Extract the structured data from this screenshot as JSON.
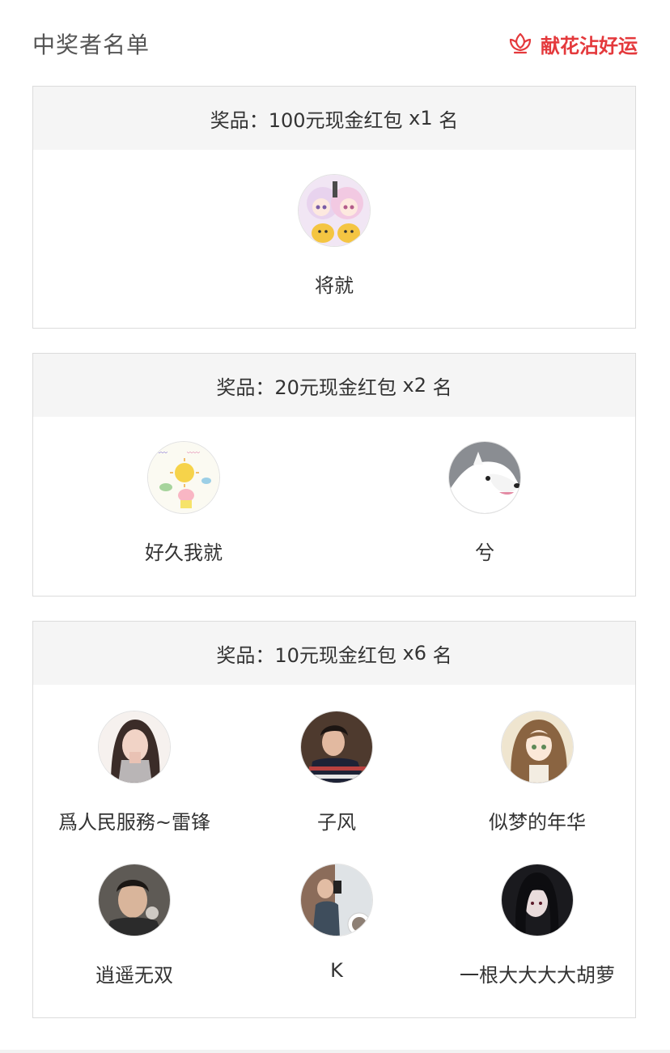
{
  "header": {
    "title": "中奖者名单",
    "flower_label": "献花沾好运",
    "accent_color": "#e4393c"
  },
  "prizes": [
    {
      "prefix": "奖品：",
      "prize": "100元现金红包",
      "count": "x1",
      "unit": "名",
      "winners": [
        {
          "name": "将就",
          "avatar": "anime-girls-avatar"
        }
      ]
    },
    {
      "prefix": "奖品：",
      "prize": "20元现金红包",
      "count": "x2",
      "unit": "名",
      "winners": [
        {
          "name": "好久我就",
          "avatar": "drawing-avatar"
        },
        {
          "name": "兮",
          "avatar": "white-dog-avatar"
        }
      ]
    },
    {
      "prefix": "奖品：",
      "prize": "10元现金红包",
      "count": "x6",
      "unit": "名",
      "winners": [
        {
          "name": "爲人民服務~雷锋",
          "avatar": "woman-selfie-avatar"
        },
        {
          "name": "子风",
          "avatar": "man-striped-shirt-avatar"
        },
        {
          "name": "似梦的年华",
          "avatar": "anime-brown-hair-avatar"
        },
        {
          "name": "逍遥无双",
          "avatar": "man-portrait-avatar"
        },
        {
          "name": "K",
          "avatar": "mirror-selfie-avatar"
        },
        {
          "name": "一根大大大大胡萝",
          "avatar": "anime-dark-hair-avatar"
        }
      ]
    }
  ]
}
